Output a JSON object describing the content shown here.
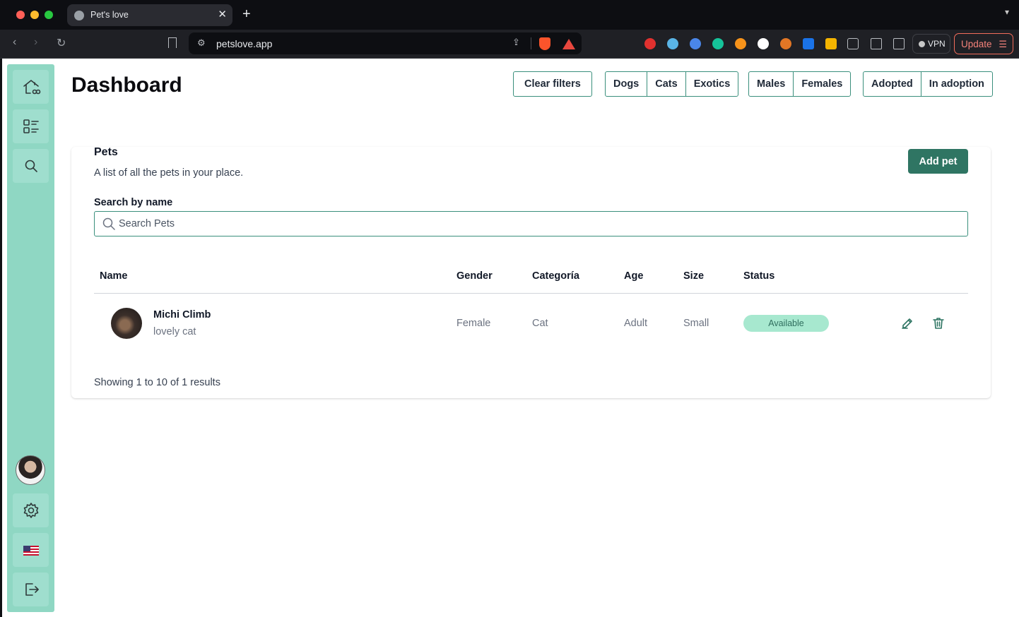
{
  "browser": {
    "tab_title": "Pet's love",
    "new_tab": "+",
    "tab_close": "✕",
    "url": "petslove.app",
    "vpn_label": "VPN",
    "update_label": "Update",
    "extension_colors": [
      "#e0312f",
      "#5ab4e5",
      "#4a86e8",
      "#15c39a",
      "#f7931a",
      "#ffffff",
      "#e27625",
      "#1a73e8",
      "#f4b400"
    ]
  },
  "page": {
    "title": "Dashboard"
  },
  "filters": {
    "clear": "Clear filters",
    "species": [
      "Dogs",
      "Cats",
      "Exotics"
    ],
    "gender": [
      "Males",
      "Females"
    ],
    "adoption": [
      "Adopted",
      "In adoption"
    ]
  },
  "pets_card": {
    "title": "Pets",
    "subtitle": "A list of all the pets in your place.",
    "add_button": "Add pet",
    "search_label": "Search by name",
    "search_placeholder": "Search Pets",
    "search_value": "",
    "columns": [
      "Name",
      "Gender",
      "Categoría",
      "Age",
      "Size",
      "Status"
    ],
    "rows": [
      {
        "name": "Michi Climb",
        "description": "lovely cat",
        "gender": "Female",
        "category": "Cat",
        "age": "Adult",
        "size": "Small",
        "status": "Available"
      }
    ],
    "pagination_text": "Showing 1 to 10 of 1 results"
  },
  "colors": {
    "sidebar": "#8fd7c3",
    "accent": "#2f7563",
    "status_available_bg": "#a7e8cf"
  }
}
